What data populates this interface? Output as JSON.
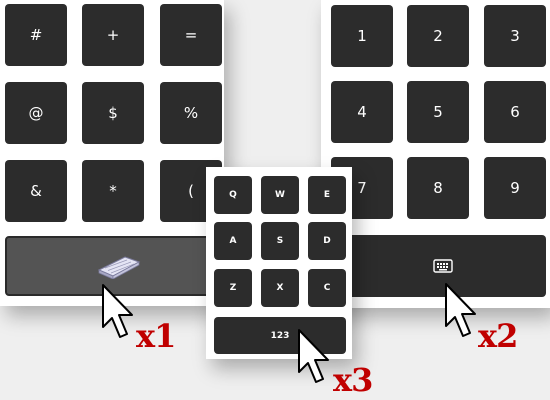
{
  "symbols_panel": {
    "keys": [
      "#",
      "+",
      "=",
      "@",
      "$",
      "%",
      "&",
      "*",
      "("
    ],
    "keyboard_key_icon": "keyboard-icon"
  },
  "numbers_panel": {
    "keys": [
      "1",
      "2",
      "3",
      "4",
      "5",
      "6",
      "7",
      "8",
      "9"
    ],
    "keyboard_key_icon": "keyboard-icon"
  },
  "letters_panel": {
    "keys": [
      "Q",
      "W",
      "E",
      "A",
      "S",
      "D",
      "Z",
      "X",
      "C"
    ],
    "numbers_key_label": "123"
  },
  "annotations": {
    "badge_1": "x1",
    "badge_2": "x2",
    "badge_3": "x3"
  },
  "colors": {
    "key_bg": "#2c2c2c",
    "active_key_bg": "#545454",
    "badge": "#c00000"
  }
}
